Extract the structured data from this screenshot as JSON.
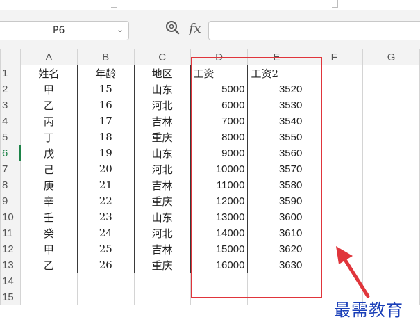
{
  "formula_bar": {
    "cell_reference": "P6",
    "fx_label": "fx",
    "formula_value": ""
  },
  "columns": [
    "A",
    "B",
    "C",
    "D",
    "E",
    "F",
    "G"
  ],
  "row_numbers": [
    "1",
    "2",
    "3",
    "4",
    "5",
    "6",
    "7",
    "8",
    "9",
    "10",
    "11",
    "12",
    "13",
    "14",
    "15"
  ],
  "active_row": "6",
  "rows": [
    [
      "姓名",
      "年龄",
      "地区",
      "工资",
      "工资2"
    ],
    [
      "甲",
      "15",
      "山东",
      "5000",
      "3520"
    ],
    [
      "乙",
      "16",
      "河北",
      "6000",
      "3530"
    ],
    [
      "丙",
      "17",
      "吉林",
      "7000",
      "3540"
    ],
    [
      "丁",
      "18",
      "重庆",
      "8000",
      "3550"
    ],
    [
      "戊",
      "19",
      "山东",
      "9000",
      "3560"
    ],
    [
      "己",
      "20",
      "河北",
      "10000",
      "3570"
    ],
    [
      "庚",
      "21",
      "吉林",
      "11000",
      "3580"
    ],
    [
      "辛",
      "22",
      "重庆",
      "12000",
      "3590"
    ],
    [
      "壬",
      "23",
      "山东",
      "13000",
      "3600"
    ],
    [
      "癸",
      "24",
      "河北",
      "14000",
      "3610"
    ],
    [
      "甲",
      "25",
      "吉林",
      "15000",
      "3620"
    ],
    [
      "乙",
      "26",
      "重庆",
      "16000",
      "3630"
    ]
  ],
  "highlight_color": "#e0353b",
  "watermark_text": "最需教育",
  "watermark_color": "#1a3fb8"
}
